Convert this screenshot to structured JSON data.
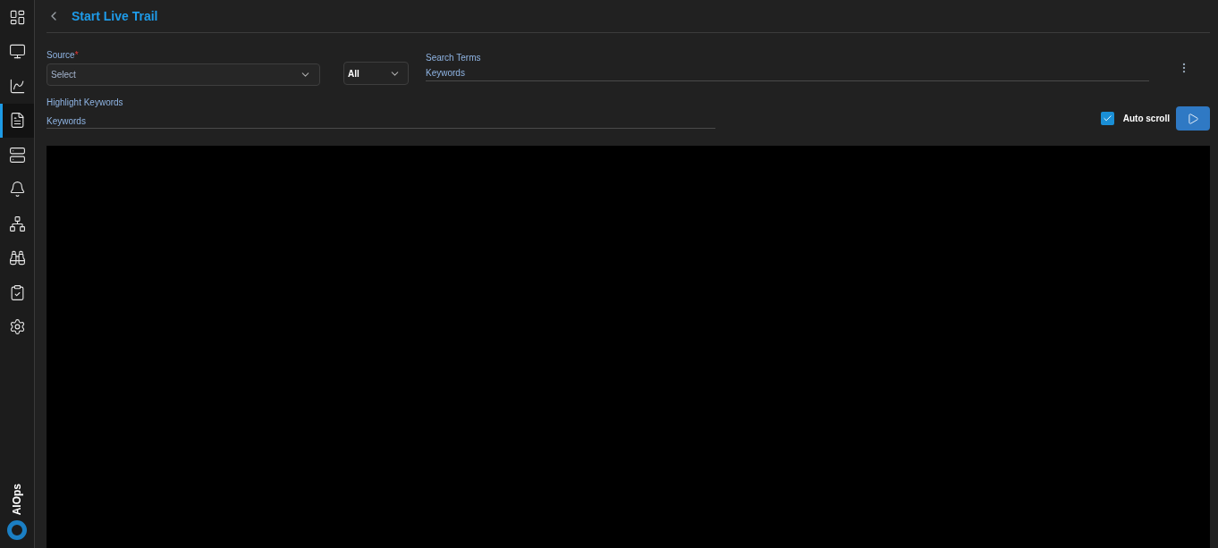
{
  "sidebar": {
    "items": [
      {
        "kind": "dashboard",
        "selected": false
      },
      {
        "kind": "monitor",
        "selected": false
      },
      {
        "kind": "chart",
        "selected": false
      },
      {
        "kind": "document",
        "selected": true
      },
      {
        "kind": "server",
        "selected": false
      },
      {
        "kind": "bell",
        "selected": false
      },
      {
        "kind": "network",
        "selected": false
      },
      {
        "kind": "binoculars",
        "selected": false
      },
      {
        "kind": "clipboard",
        "selected": false
      },
      {
        "kind": "settings",
        "selected": false
      }
    ],
    "brand": "AIOps"
  },
  "header": {
    "title": "Start Live Trail"
  },
  "form": {
    "source": {
      "label": "Source",
      "required_mark": "*",
      "placeholder": "Select"
    },
    "level": {
      "value": "All"
    },
    "search_terms": {
      "label": "Search Terms",
      "placeholder": "Keywords"
    },
    "highlight": {
      "label": "Highlight Keywords",
      "placeholder": "Keywords"
    },
    "auto_scroll": {
      "label": "Auto scroll",
      "checked": true
    }
  }
}
